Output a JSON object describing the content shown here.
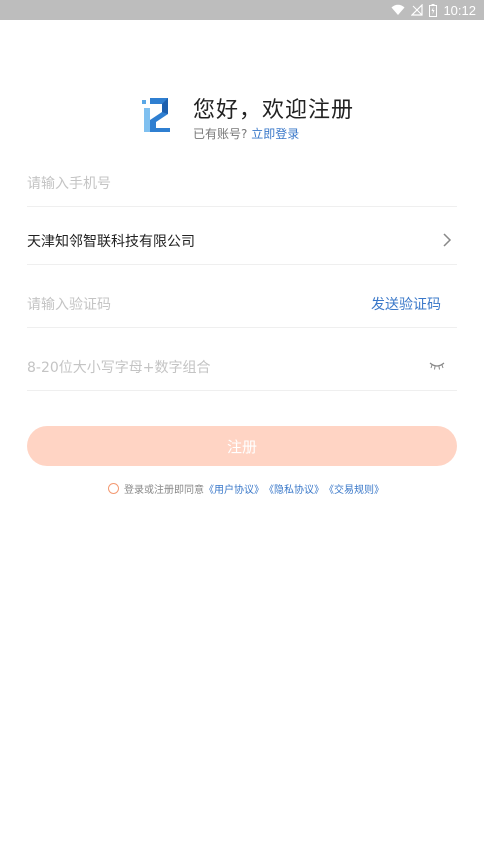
{
  "status_bar": {
    "time": "10:12"
  },
  "header": {
    "title": "您好，欢迎注册",
    "subtitle_prefix": "已有账号?",
    "login_link": "立即登录"
  },
  "form": {
    "phone_placeholder": "请输入手机号",
    "company_value": "天津知邻智联科技有限公司",
    "code_placeholder": "请输入验证码",
    "send_code_label": "发送验证码",
    "password_placeholder": "8-20位大小写字母+数字组合"
  },
  "register_button": {
    "label": "注册"
  },
  "agreement": {
    "prefix": "登录或注册即同意",
    "user_agreement": "《用户协议》",
    "privacy_agreement": "《隐私协议》",
    "trade_rules": "《交易规则》"
  },
  "colors": {
    "accent": "#3a78c9",
    "button_bg": "#ffd4c4",
    "status_bar": "#bdbdbd"
  }
}
